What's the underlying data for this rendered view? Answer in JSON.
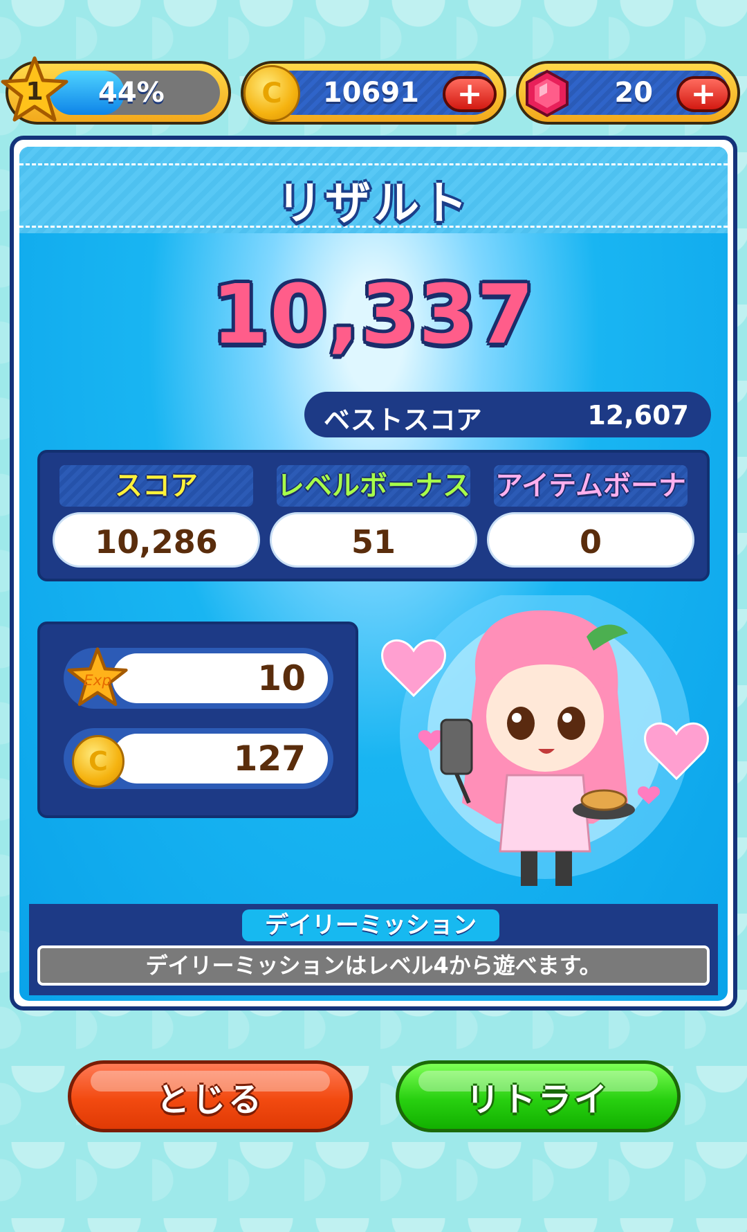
{
  "top_bar": {
    "level": "1",
    "level_progress_text": "44%",
    "level_progress": 0.44,
    "coins": "10691",
    "gems": "20",
    "plus_symbol": "+"
  },
  "result": {
    "title": "リザルト",
    "total_score": "10,337",
    "best_score_label": "ベストスコア",
    "best_score": "12,607"
  },
  "breakdown": [
    {
      "label": "スコア",
      "value": "10,286",
      "color": "#fff23a"
    },
    {
      "label": "レベルボーナス",
      "value": "51",
      "color": "#a8ff4a"
    },
    {
      "label": "アイテムボーナス",
      "value": "0",
      "color": "#ffb0ee"
    }
  ],
  "rewards": {
    "exp_icon_text": "Exp",
    "exp": "10",
    "coins": "127",
    "coin_icon_text": "C"
  },
  "daily_mission": {
    "title": "デイリーミッション",
    "message": "デイリーミッションはレベル4から遊べます。"
  },
  "buttons": {
    "close": "とじる",
    "retry": "リトライ"
  },
  "colors": {
    "panel_blue": "#0aa3ea",
    "navy": "#1d3a86",
    "score_pink": "#ff5d8a",
    "close_orange": "#f24a10",
    "retry_green": "#28d010"
  }
}
